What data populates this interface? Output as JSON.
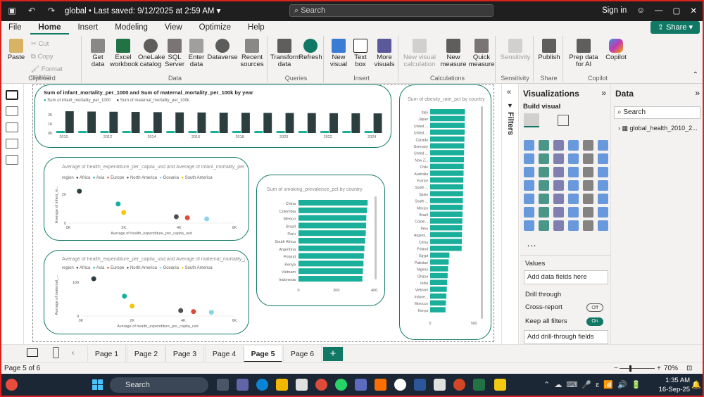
{
  "titlebar": {
    "title": "global",
    "saved": "• Last saved: 9/12/2025 at 2:59 AM",
    "search": "Search",
    "signin": "Sign in"
  },
  "menu": [
    "File",
    "Home",
    "Insert",
    "Modeling",
    "View",
    "Optimize",
    "Help"
  ],
  "share_label": "Share",
  "ribbon": {
    "clipboard": {
      "paste": "Paste",
      "cut": "Cut",
      "copy": "Copy",
      "format_painter": "Format painter",
      "label": "Clipboard"
    },
    "data": {
      "get_data": "Get data",
      "excel": "Excel workbook",
      "onelake": "OneLake catalog",
      "sql": "SQL Server",
      "enter": "Enter data",
      "dataverse": "Dataverse",
      "recent": "Recent sources",
      "label": "Data"
    },
    "queries": {
      "transform": "Transform data",
      "refresh": "Refresh",
      "label": "Queries"
    },
    "insert": {
      "new_visual": "New visual",
      "text_box": "Text box",
      "more_visuals": "More visuals",
      "label": "Insert"
    },
    "calculations": {
      "new_visual_calc": "New visual calculation",
      "new_measure": "New measure",
      "quick_measure": "Quick measure",
      "label": "Calculations"
    },
    "sensitivity": {
      "btn": "Sensitivity",
      "label": "Sensitivity"
    },
    "share": {
      "publish": "Publish",
      "label": "Share"
    },
    "copilot": {
      "prep": "Prep data for AI",
      "copilot": "Copilot",
      "label": "Copilot"
    }
  },
  "visuals": {
    "v1": {
      "title": "Sum of infant_mortality_per_1000 and Sum of maternal_mortality_per_100k by year",
      "legend": [
        "Sum of infant_mortality_per_1000",
        "Sum of maternal_mortality_per_100k"
      ]
    },
    "v2": {
      "title": "Average of health_expenditure_per_capita_usd and Average of infant_mortality_per_1000 by re...",
      "legend_title": "region",
      "legend": [
        "Africa",
        "Asia",
        "Europe",
        "North America",
        "Oceania",
        "South America"
      ],
      "xlabel": "Average of health_expenditure_per_capita_usd",
      "ylabel": "Average of infant_m..."
    },
    "v3": {
      "title": "Average of health_expenditure_per_capita_usd and Average of maternal_mortality_per_10...",
      "legend_title": "region",
      "legend": [
        "Africa",
        "Asia",
        "Europe",
        "North America",
        "Oceania",
        "South America"
      ],
      "xlabel": "Average of health_expenditure_per_capita_usd",
      "ylabel": "Average of maternal_..."
    },
    "v4": {
      "title": "Sum of smoking_prevalence_pct by country"
    },
    "v5": {
      "title": "Sum of obesity_rate_pct by country"
    }
  },
  "chart_data": [
    {
      "type": "bar",
      "title": "Sum of infant_mortality_per_1000 and Sum of maternal_mortality_per_100k by year",
      "categories": [
        "2010",
        "2011",
        "2012",
        "2013",
        "2014",
        "2015",
        "2016",
        "2017",
        "2018",
        "2019",
        "2020",
        "2021",
        "2022",
        "2023",
        "2024"
      ],
      "x_tick_labels": [
        "2010",
        "2012",
        "2014",
        "2016",
        "2018",
        "2020",
        "2022",
        "2024"
      ],
      "y_ticks": [
        "2K",
        "1K",
        "0K"
      ],
      "series": [
        {
          "name": "Sum of infant_mortality_per_1000",
          "values": [
            170,
            168,
            166,
            165,
            163,
            162,
            160,
            158,
            157,
            156,
            154,
            152,
            150,
            149,
            147
          ]
        },
        {
          "name": "Sum of maternal_mortality_per_100k",
          "values": [
            2150,
            2120,
            2100,
            2080,
            2060,
            2040,
            2030,
            2010,
            2000,
            1990,
            1980,
            1970,
            1960,
            1950,
            1940
          ]
        }
      ],
      "colors": [
        "#1aaf9b",
        "#2d3e40"
      ],
      "ylim": [
        0,
        2500
      ]
    },
    {
      "type": "scatter",
      "title": "Average of health_expenditure_per_capita_usd and Average of infant_mortality_per_1000 by re...",
      "xlabel": "Average of health_expenditure_per_capita_usd",
      "ylabel": "Average of infant_m...",
      "x_ticks": [
        "0K",
        "2K",
        "4K",
        "6K"
      ],
      "y_ticks": [
        "20",
        "0"
      ],
      "xlim": [
        0,
        6000
      ],
      "ylim": [
        0,
        35
      ],
      "points": [
        {
          "name": "Africa",
          "x": 400,
          "y": 30,
          "color": "#2d3e40"
        },
        {
          "name": "Asia",
          "x": 1800,
          "y": 18,
          "color": "#1aaf9b"
        },
        {
          "name": "Europe",
          "x": 4300,
          "y": 5,
          "color": "#e0493a"
        },
        {
          "name": "North America",
          "x": 3900,
          "y": 6,
          "color": "#505050"
        },
        {
          "name": "Oceania",
          "x": 5000,
          "y": 4,
          "color": "#8ad4eb"
        },
        {
          "name": "South America",
          "x": 2000,
          "y": 10,
          "color": "#f2c80f"
        }
      ]
    },
    {
      "type": "scatter",
      "title": "Average of health_expenditure_per_capita_usd and Average of maternal_mortality_per_10...",
      "xlabel": "Average of health_expenditure_per_capita_usd",
      "ylabel": "Average of maternal_...",
      "x_ticks": [
        "0K",
        "2K",
        "4K",
        "6K"
      ],
      "y_ticks": [
        "100",
        "0"
      ],
      "xlim": [
        0,
        6000
      ],
      "ylim": [
        0,
        170
      ],
      "points": [
        {
          "name": "Africa",
          "x": 500,
          "y": 150,
          "color": "#2d3e40"
        },
        {
          "name": "Asia",
          "x": 1700,
          "y": 80,
          "color": "#1aaf9b"
        },
        {
          "name": "Europe",
          "x": 4400,
          "y": 18,
          "color": "#e0493a"
        },
        {
          "name": "North America",
          "x": 3900,
          "y": 22,
          "color": "#505050"
        },
        {
          "name": "Oceania",
          "x": 5100,
          "y": 15,
          "color": "#8ad4eb"
        },
        {
          "name": "South America",
          "x": 2000,
          "y": 40,
          "color": "#f2c80f"
        }
      ]
    },
    {
      "type": "bar",
      "orientation": "horizontal",
      "title": "Sum of smoking_prevalence_pct by country",
      "categories": [
        "China",
        "Colombia",
        "Mexico",
        "Brazil",
        "Peru",
        "South Africa",
        "Argentina",
        "Poland",
        "Kenya",
        "Vietnam",
        "Indonesia"
      ],
      "values": [
        365,
        362,
        358,
        357,
        355,
        352,
        348,
        345,
        343,
        340,
        337
      ],
      "x_ticks": [
        "0",
        "200",
        "400"
      ],
      "xlim": [
        0,
        420
      ],
      "color": "#1aaf9b"
    },
    {
      "type": "bar",
      "orientation": "horizontal",
      "title": "Sum of obesity_rate_pct by country",
      "categories": [
        "Italy",
        "Japan",
        "United ...",
        "United ...",
        "Canada",
        "Germany",
        "United ...",
        "Now Z...",
        "Chile",
        "Australia",
        "France",
        "South ...",
        "Spain",
        "South ...",
        "Mexico",
        "Brazil",
        "Colom...",
        "Peru",
        "Argenti...",
        "China",
        "Poland",
        "Egypt",
        "Pakistan",
        "Nigeria",
        "Ghana",
        "India",
        "Vietnam",
        "Indone...",
        "Morocco",
        "Kenya"
      ],
      "values": [
        398,
        396,
        395,
        394,
        392,
        390,
        388,
        386,
        384,
        382,
        380,
        378,
        376,
        374,
        372,
        370,
        368,
        366,
        364,
        362,
        360,
        220,
        212,
        205,
        200,
        195,
        190,
        185,
        180,
        175
      ],
      "x_ticks": [
        "0",
        "500"
      ],
      "xlim": [
        0,
        700
      ],
      "color": "#1aaf9b"
    }
  ],
  "filters_label": "Filters",
  "viz_pane": {
    "title": "Visualizations",
    "build": "Build visual",
    "values": "Values",
    "add_fields": "Add data fields here",
    "drill": "Drill through",
    "cross_report": "Cross-report",
    "cross_toggle": "Off",
    "keep_filters": "Keep all filters",
    "keep_toggle": "On",
    "add_drill": "Add drill-through fields here"
  },
  "data_pane": {
    "title": "Data",
    "search": "Search",
    "table": "global_health_2010_2..."
  },
  "pages": [
    "Page 1",
    "Page 2",
    "Page 3",
    "Page 4",
    "Page 5",
    "Page 6"
  ],
  "active_page": "Page 5",
  "status": {
    "page": "Page 5 of 6",
    "zoom": "70%"
  },
  "taskbar": {
    "search": "Search",
    "time": "1:35 AM",
    "date": "16-Sep-25"
  }
}
